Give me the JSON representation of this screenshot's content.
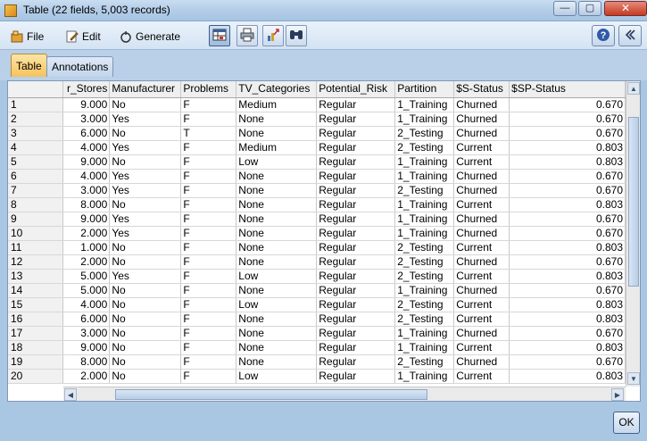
{
  "window": {
    "title": "Table (22 fields, 5,003 records)",
    "minimize": "—",
    "maximize": "▢",
    "close": "✕"
  },
  "menu": {
    "file": "File",
    "edit": "Edit",
    "generate": "Generate"
  },
  "toolbar": {
    "icons": [
      "table-view-icon",
      "print-icon",
      "chart-export-icon",
      "binoculars-icon"
    ],
    "help": "?",
    "collapse": "«"
  },
  "tabs": {
    "table": "Table",
    "annotations": "Annotations"
  },
  "grid": {
    "columns": [
      "r_Stores",
      "Manufacturer",
      "Problems",
      "TV_Categories",
      "Potential_Risk",
      "Partition",
      "$S-Status",
      "$SP-Status"
    ],
    "rows": [
      [
        "1",
        "9.000",
        "No",
        "F",
        "Medium",
        "Regular",
        "1_Training",
        "Churned",
        "0.670"
      ],
      [
        "2",
        "3.000",
        "Yes",
        "F",
        "None",
        "Regular",
        "1_Training",
        "Churned",
        "0.670"
      ],
      [
        "3",
        "6.000",
        "No",
        "T",
        "None",
        "Regular",
        "2_Testing",
        "Churned",
        "0.670"
      ],
      [
        "4",
        "4.000",
        "Yes",
        "F",
        "Medium",
        "Regular",
        "2_Testing",
        "Current",
        "0.803"
      ],
      [
        "5",
        "9.000",
        "No",
        "F",
        "Low",
        "Regular",
        "1_Training",
        "Current",
        "0.803"
      ],
      [
        "6",
        "4.000",
        "Yes",
        "F",
        "None",
        "Regular",
        "1_Training",
        "Churned",
        "0.670"
      ],
      [
        "7",
        "3.000",
        "Yes",
        "F",
        "None",
        "Regular",
        "2_Testing",
        "Churned",
        "0.670"
      ],
      [
        "8",
        "8.000",
        "No",
        "F",
        "None",
        "Regular",
        "1_Training",
        "Current",
        "0.803"
      ],
      [
        "9",
        "9.000",
        "Yes",
        "F",
        "None",
        "Regular",
        "1_Training",
        "Churned",
        "0.670"
      ],
      [
        "10",
        "2.000",
        "Yes",
        "F",
        "None",
        "Regular",
        "1_Training",
        "Churned",
        "0.670"
      ],
      [
        "11",
        "1.000",
        "No",
        "F",
        "None",
        "Regular",
        "2_Testing",
        "Current",
        "0.803"
      ],
      [
        "12",
        "2.000",
        "No",
        "F",
        "None",
        "Regular",
        "2_Testing",
        "Churned",
        "0.670"
      ],
      [
        "13",
        "5.000",
        "Yes",
        "F",
        "Low",
        "Regular",
        "2_Testing",
        "Current",
        "0.803"
      ],
      [
        "14",
        "5.000",
        "No",
        "F",
        "None",
        "Regular",
        "1_Training",
        "Churned",
        "0.670"
      ],
      [
        "15",
        "4.000",
        "No",
        "F",
        "Low",
        "Regular",
        "2_Testing",
        "Current",
        "0.803"
      ],
      [
        "16",
        "6.000",
        "No",
        "F",
        "None",
        "Regular",
        "2_Testing",
        "Current",
        "0.803"
      ],
      [
        "17",
        "3.000",
        "No",
        "F",
        "None",
        "Regular",
        "1_Training",
        "Churned",
        "0.670"
      ],
      [
        "18",
        "9.000",
        "No",
        "F",
        "None",
        "Regular",
        "1_Training",
        "Current",
        "0.803"
      ],
      [
        "19",
        "8.000",
        "No",
        "F",
        "None",
        "Regular",
        "2_Testing",
        "Churned",
        "0.670"
      ],
      [
        "20",
        "2.000",
        "No",
        "F",
        "Low",
        "Regular",
        "1_Training",
        "Current",
        "0.803"
      ]
    ]
  },
  "footer": {
    "ok": "OK"
  },
  "colors": {
    "active_tab": "#f4c25c",
    "title_bar": "#b3cde8",
    "close": "#c33b22"
  }
}
